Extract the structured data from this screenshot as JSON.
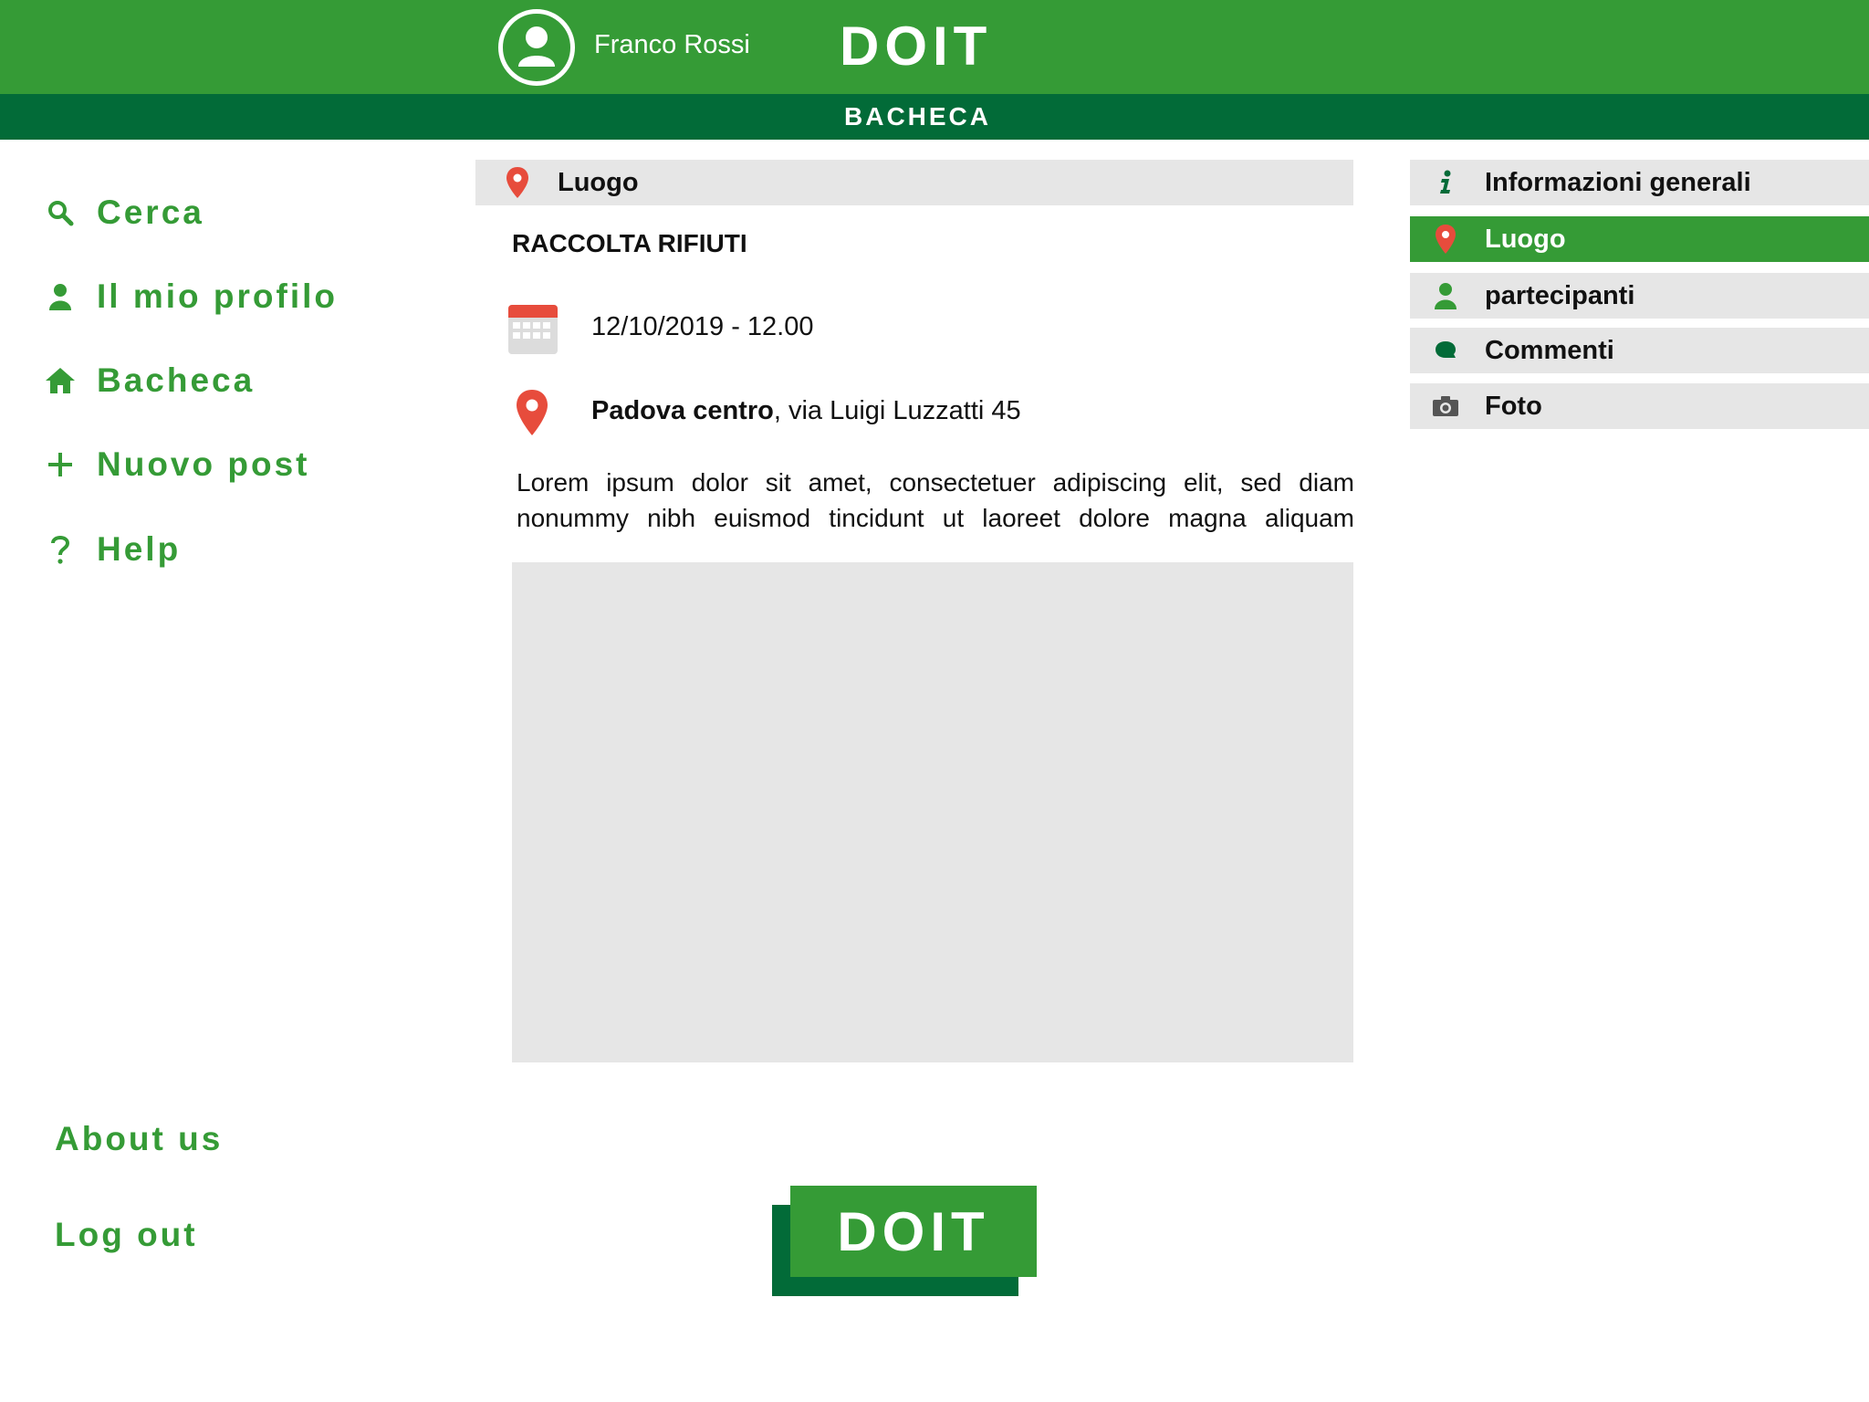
{
  "header": {
    "user_name": "Franco Rossi",
    "brand": "DOIT",
    "section_title": "BACHECA"
  },
  "colors": {
    "primary_green": "#359b36",
    "dark_green": "#026b38",
    "panel_gray": "#e6e6e6",
    "pin_red": "#e74c3c"
  },
  "nav": {
    "items": [
      {
        "label": "Cerca",
        "icon": "search-icon"
      },
      {
        "label": "Il mio profilo",
        "icon": "user-icon"
      },
      {
        "label": "Bacheca",
        "icon": "home-icon"
      },
      {
        "label": "Nuovo post",
        "icon": "plus-icon"
      },
      {
        "label": "Help",
        "icon": "help-icon"
      }
    ],
    "about_label": "About us",
    "logout_label": "Log out"
  },
  "post": {
    "section_label": "Luogo",
    "title": "RACCOLTA RIFIUTI",
    "date": "12/10/2019 - 12.00",
    "location_bold": "Padova centro",
    "location_rest": ", via Luigi Luzzatti 45",
    "description": "Lorem ipsum dolor sit amet, consectetuer adipiscing elit, sed diam nonummy nibh euismod tincidunt ut laoreet dolore magna aliquam"
  },
  "tabs": [
    {
      "label": "Informazioni generali",
      "icon": "info-icon",
      "active": false
    },
    {
      "label": "Luogo",
      "icon": "location-pin-icon",
      "active": true
    },
    {
      "label": "partecipanti",
      "icon": "user-icon",
      "active": false
    },
    {
      "label": "Commenti",
      "icon": "comment-icon",
      "active": false
    },
    {
      "label": "Foto",
      "icon": "camera-icon",
      "active": false
    }
  ],
  "footer": {
    "logo_text": "DOIT"
  }
}
